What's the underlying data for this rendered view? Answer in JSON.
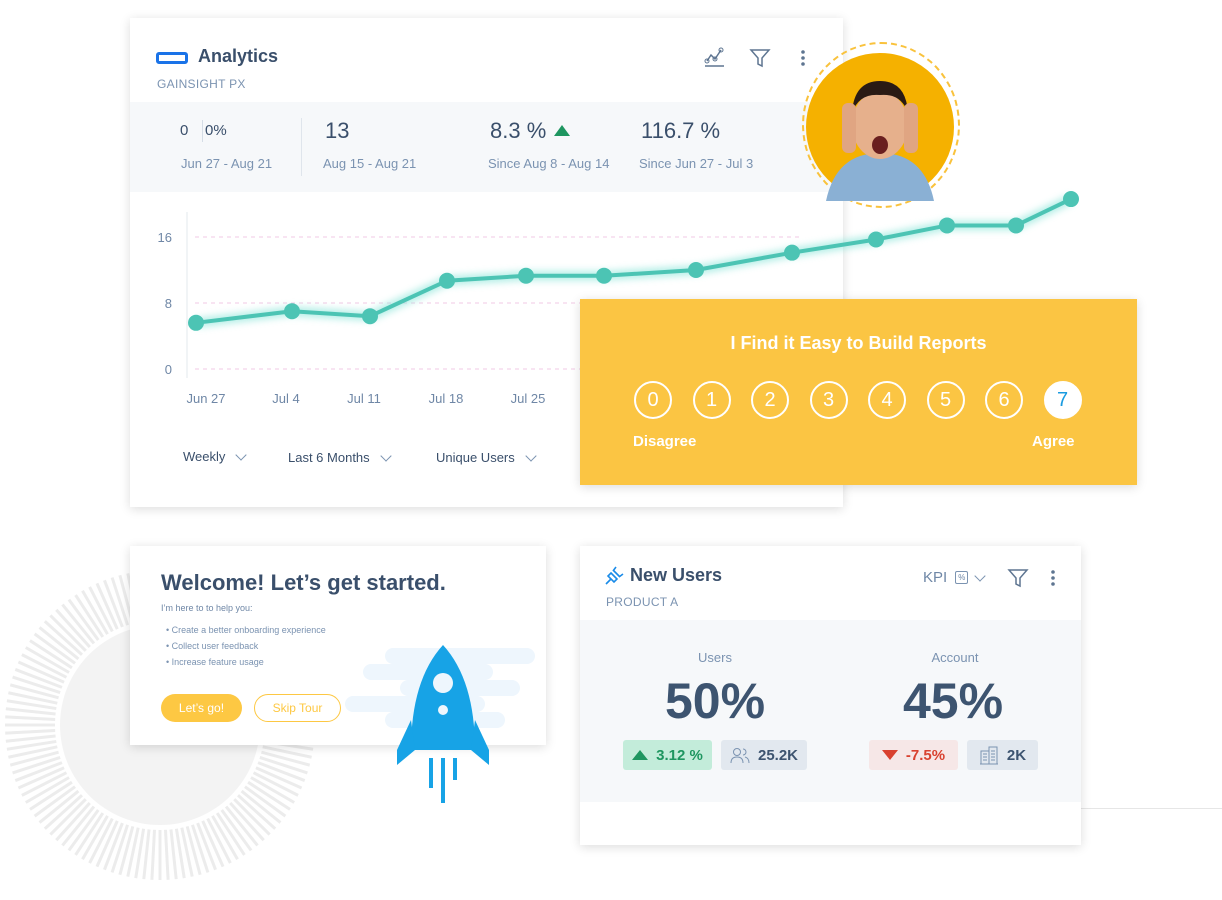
{
  "analytics": {
    "title": "Analytics",
    "subtitle": "GAINSIGHT PX",
    "icons": [
      "chart-line-icon",
      "filter-icon",
      "more-vertical-icon"
    ],
    "stats": [
      {
        "value": "0",
        "value2": "0%",
        "label": "Jun 27 - Aug 21"
      },
      {
        "value": "13",
        "label": "Aug 15 - Aug 21"
      },
      {
        "value": "8.3 %",
        "trend": "up",
        "label": "Since Aug 8 - Aug 14"
      },
      {
        "value": "116.7 %",
        "label": "Since Jun 27 - Jul 3"
      }
    ],
    "dropdowns": [
      "Weekly",
      "Last 6 Months",
      "Unique Users"
    ]
  },
  "chart_data": {
    "type": "line",
    "x_tick_labels": [
      "Jun 27",
      "Jul 4",
      "Jul 11",
      "Jul 18",
      "Jul 25"
    ],
    "y_tick_labels": [
      "16",
      "8",
      "0"
    ],
    "ylim": [
      0,
      16
    ],
    "values": [
      5.6,
      7.0,
      6.4,
      10.7,
      11.3,
      11.3,
      12.0,
      14.1,
      15.7,
      17.4,
      17.4,
      20.6
    ],
    "grid": "dashed horizontal",
    "color": "#4cc4b4"
  },
  "survey": {
    "question": "I Find it Easy to Build Reports",
    "options": [
      "0",
      "1",
      "2",
      "3",
      "4",
      "5",
      "6",
      "7"
    ],
    "selected": "7",
    "low_label": "Disagree",
    "high_label": "Agree",
    "color": "#fbc543"
  },
  "welcome": {
    "title": "Welcome! Let’s get started.",
    "intro": "I’m here to to help you:",
    "bullets": [
      "Create a better onboarding experience",
      "Collect user feedback",
      "Increase feature usage"
    ],
    "primary": "Let’s go!",
    "secondary": "Skip Tour"
  },
  "new_users": {
    "title": "New Users",
    "subtitle": "PRODUCT A",
    "kpi_label": "KPI",
    "kpi_icon": "%",
    "metrics": [
      {
        "label": "Users",
        "value": "50%",
        "change": "3.12 %",
        "trend": "up",
        "count": "25.2K",
        "count_icon": "users-icon"
      },
      {
        "label": "Account",
        "value": "45%",
        "change": "-7.5%",
        "trend": "down",
        "count": "2K",
        "count_icon": "building-icon"
      }
    ]
  }
}
